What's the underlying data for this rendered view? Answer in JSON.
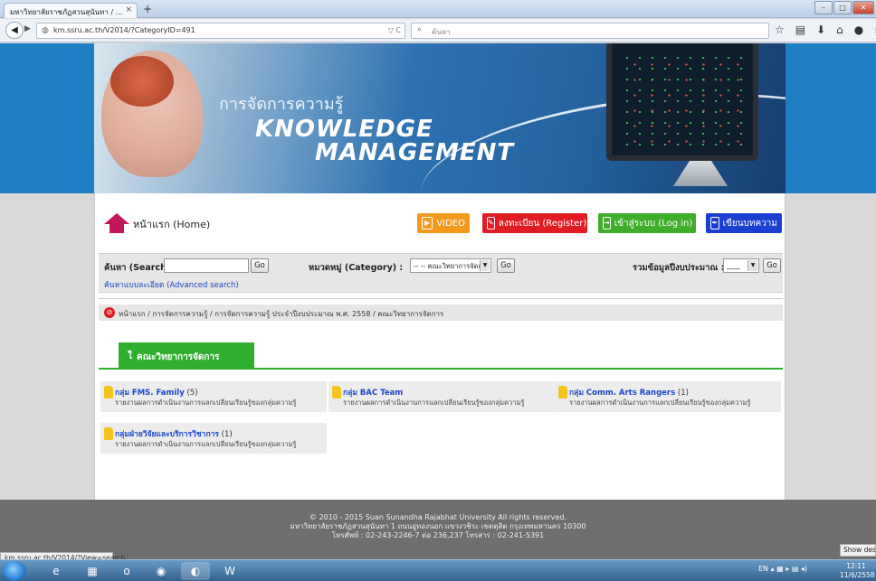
{
  "browser": {
    "tab_title": "มหาวิทยาลัยราชภัฏสวนสุนันทา / ...",
    "tab_close": "×",
    "new_tab": "+",
    "url": "km.ssru.ac.th/V2014/?CategoryID=491",
    "url_tools": "▽ C",
    "search_placeholder": "ค้นหา",
    "status_url": "km.ssru.ac.th/V2014/?View=search",
    "show_desktop": "Show desktop"
  },
  "banner": {
    "thai_title": "การจัดการความรู้",
    "line1": "KNOWLEDGE",
    "line2": "MANAGEMENT"
  },
  "home": {
    "label": "หน้าแรก (Home)"
  },
  "buttons": {
    "video": "VIDEO",
    "register": "ลงทะเบียน (Register)",
    "login": "เข้าสู่ระบบ (Log in)",
    "write": "เขียนบทความ"
  },
  "search": {
    "search_label": "ค้นหา (Search):",
    "search_value": "",
    "go": "Go",
    "category_label": "หมวดหมู่ (Category) :",
    "category_selected": "-- -- คณะวิทยาการจัดการ",
    "budget_label": "รวมข้อมูลปีงบประมาณ :",
    "budget_selected": "____",
    "advanced_link": "ค้นหาแบบละเอียด (Advanced search)"
  },
  "breadcrumb": "หน้าแรก / การจัดการความรู้ / การจัดการความรู้ ประจำปีงบประมาณ พ.ศ. 2558 / คณะวิทยาการจัดการ",
  "category_tab": "คณะวิทยาการจัดการ",
  "groups": [
    {
      "name": "กลุ่ม FMS. Family",
      "count": "(5)",
      "desc": "รายงานผลการดำเนินงานการแลกเปลี่ยนเรียนรู้ของกลุ่มความรู้"
    },
    {
      "name": "กลุ่ม BAC Team",
      "count": "",
      "desc": "รายงานผลการดำเนินงานการแลกเปลี่ยนเรียนรู้ของกลุ่มความรู้"
    },
    {
      "name": "กลุ่ม Comm. Arts Rangers",
      "count": "(1)",
      "desc": "รายงานผลการดำเนินงานการแลกเปลี่ยนเรียนรู้ของกลุ่มความรู้"
    },
    {
      "name": "กลุ่มฝ่ายวิจัยและบริการวิชาการ",
      "count": "(1)",
      "desc": "รายงานผลการดำเนินงานการแลกเปลี่ยนเรียนรู้ของกลุ่มความรู้"
    }
  ],
  "footer": {
    "line1": "© 2010 - 2015 Suan Sunandha Rajabhat University All rights reserved.",
    "line2": "มหาวิทยาลัยราชภัฏสวนสุนันทา 1 ถนนอู่ทองนอก แขวงวชิระ เขตดุสิต กรุงเทพมหานคร 10300",
    "line3": "โทรศัพท์ : 02-243-2246-7 ต่อ 236,237 โทรสาร : 02-241-5391"
  },
  "taskbar": {
    "lang": "EN",
    "time": "12:11",
    "date": "11/6/2558"
  },
  "colors": {
    "header_blue": "#1f7fc4",
    "video": "#f39a1e",
    "register": "#e11b22",
    "login": "#3fae2a",
    "write": "#1b3fd0",
    "category_green": "#2fae2f",
    "link_blue": "#1a47c7"
  }
}
